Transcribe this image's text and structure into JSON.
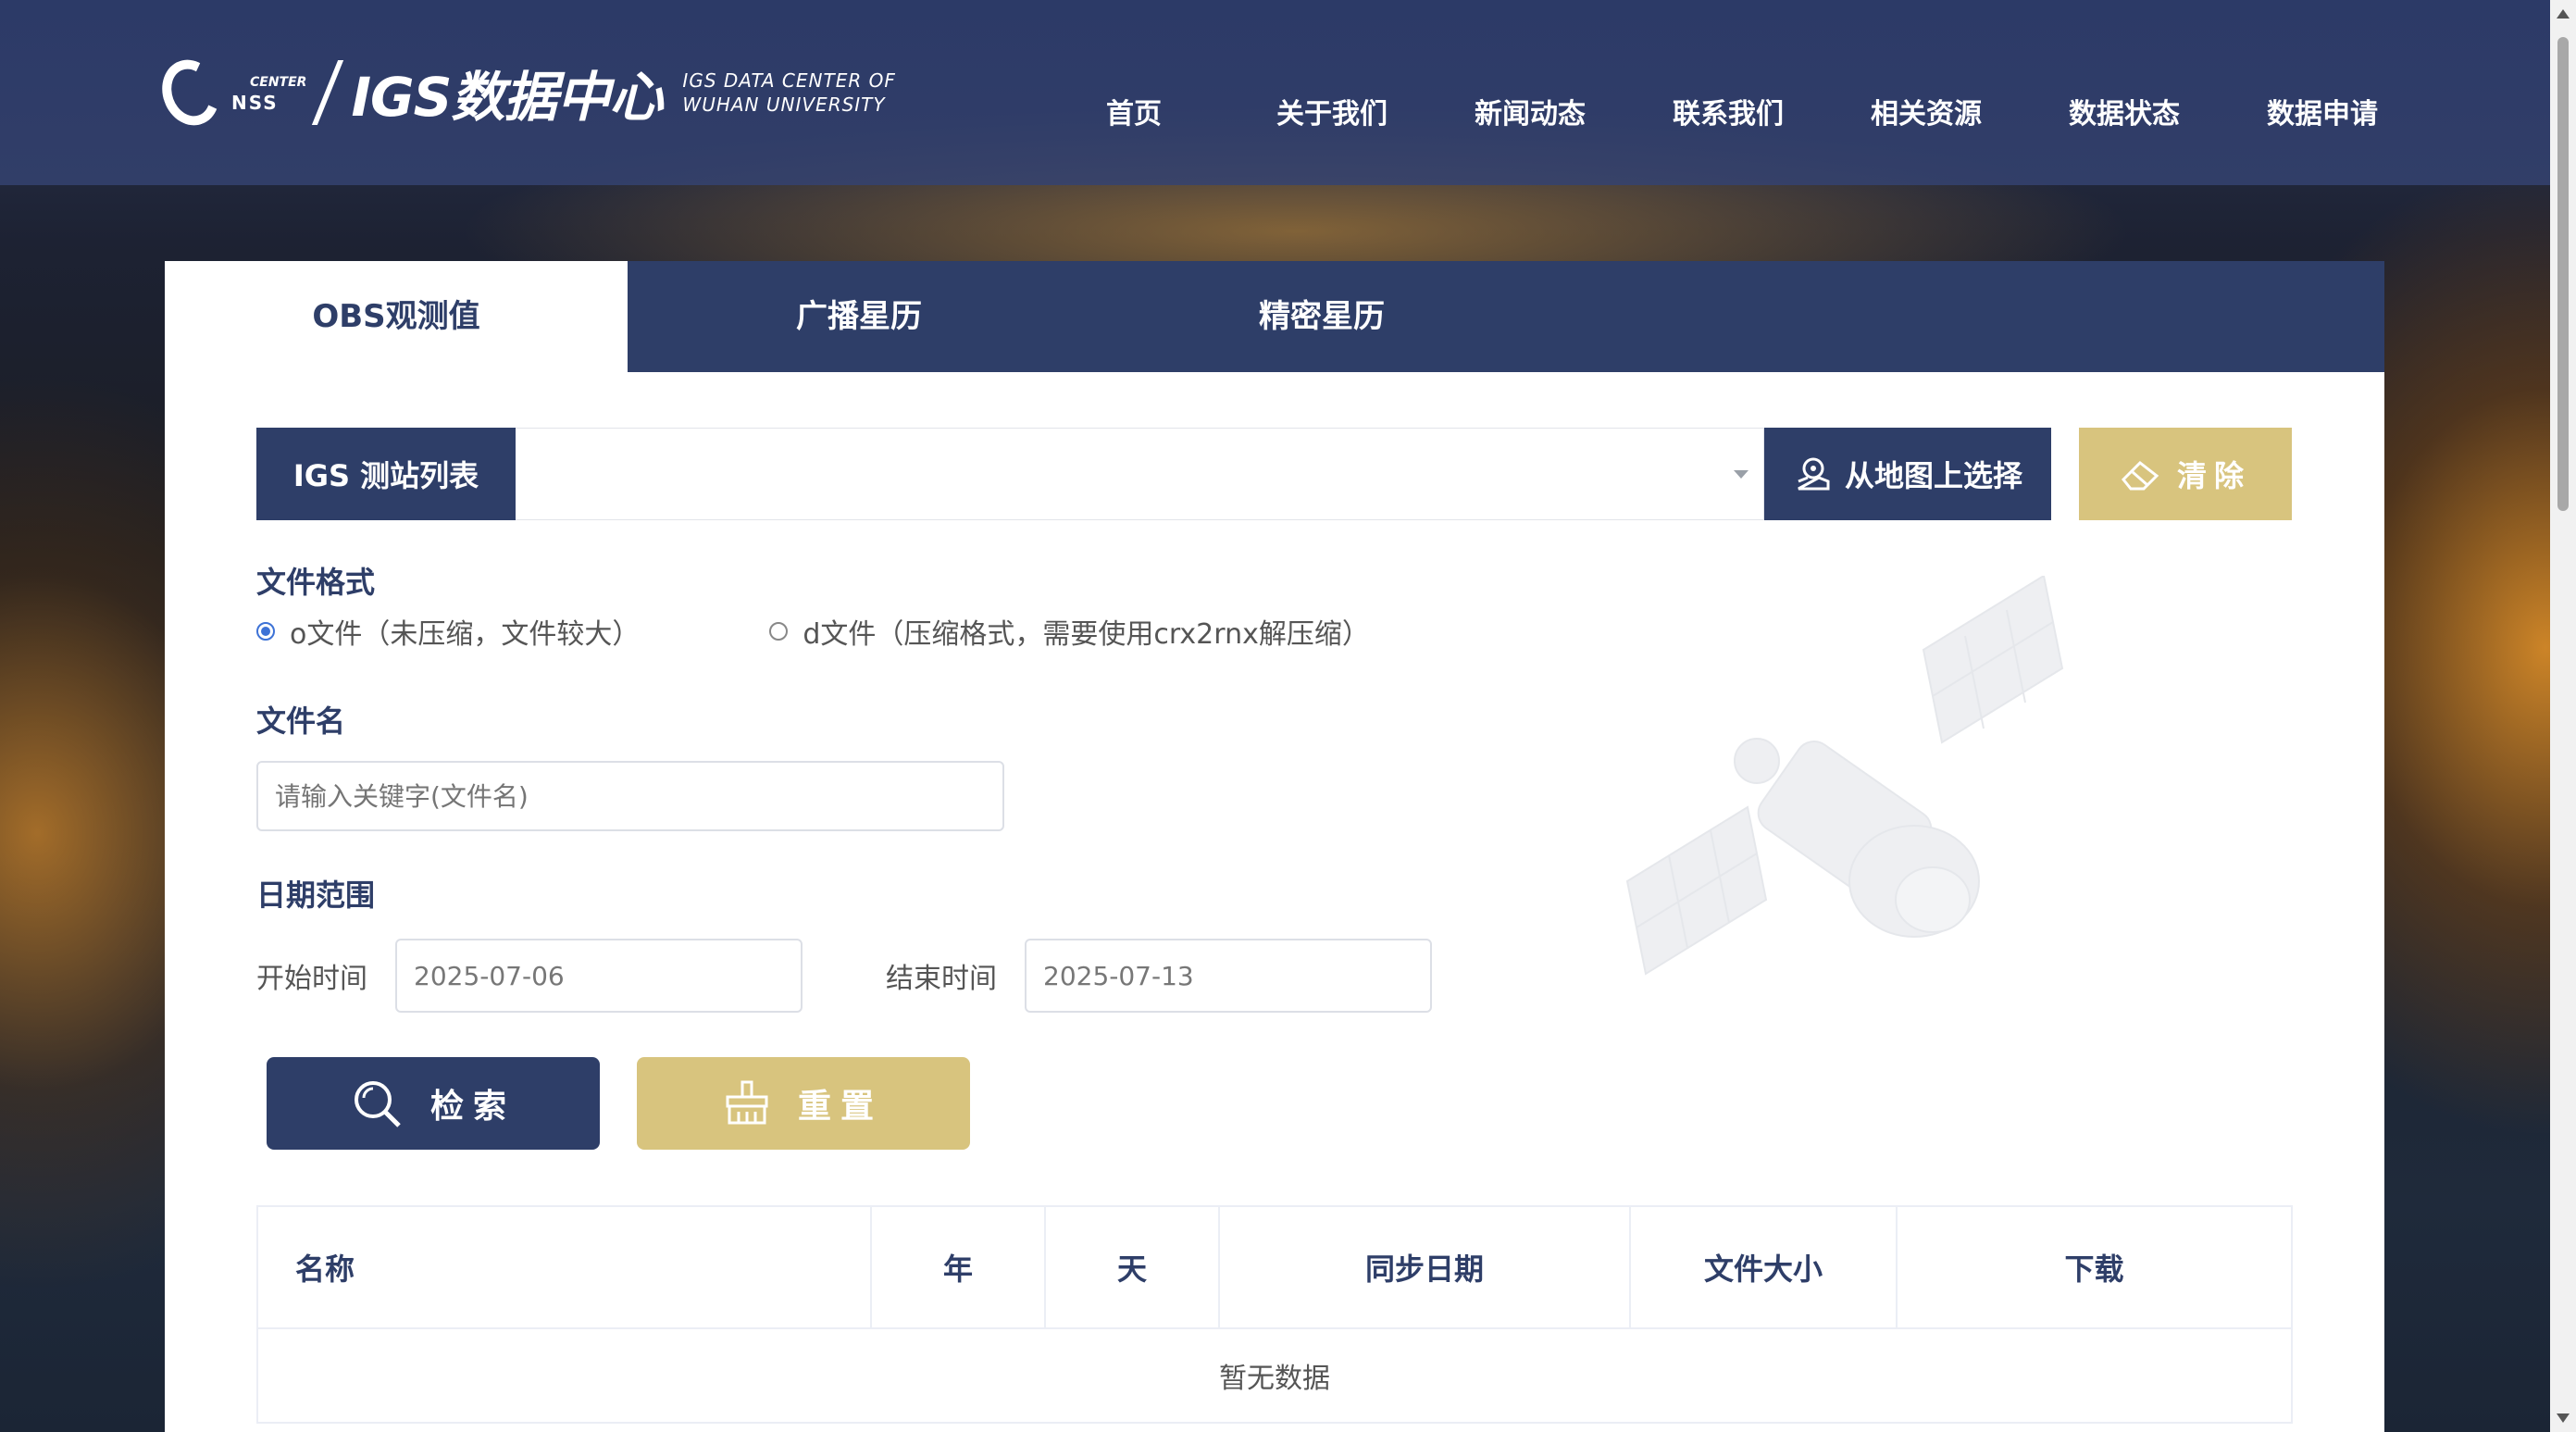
{
  "header": {
    "logo_small": "NSS",
    "logo_center": "CENTER",
    "logo_title": "IGS数据中心",
    "logo_sub_1": "IGS DATA CENTER OF",
    "logo_sub_2": "WUHAN UNIVERSITY",
    "nav": [
      "首页",
      "关于我们",
      "新闻动态",
      "联系我们",
      "相关资源",
      "数据状态",
      "数据申请"
    ]
  },
  "tabs": [
    "OBS观测值",
    "广播星历",
    "精密星历"
  ],
  "station": {
    "label": "IGS 测站列表",
    "value": "",
    "map_button": "从地图上选择",
    "clear_button": "清除"
  },
  "file_format": {
    "label": "文件格式",
    "options": [
      "o文件（未压缩，文件较大）",
      "d文件（压缩格式，需要使用crx2rnx解压缩）"
    ],
    "selected": 0
  },
  "file_name": {
    "label": "文件名",
    "placeholder": "请输入关键字(文件名)"
  },
  "date_range": {
    "label": "日期范围",
    "start_label": "开始时间",
    "start_value": "2025-07-06",
    "end_label": "结束时间",
    "end_value": "2025-07-13"
  },
  "actions": {
    "search": "检索",
    "reset": "重置"
  },
  "table": {
    "columns": [
      "名称",
      "年",
      "天",
      "同步日期",
      "文件大小",
      "下载"
    ],
    "empty_text": "暂无数据"
  },
  "colors": {
    "primary": "#2e3e68",
    "accent": "#d8c47e",
    "radio": "#3d72d6"
  }
}
